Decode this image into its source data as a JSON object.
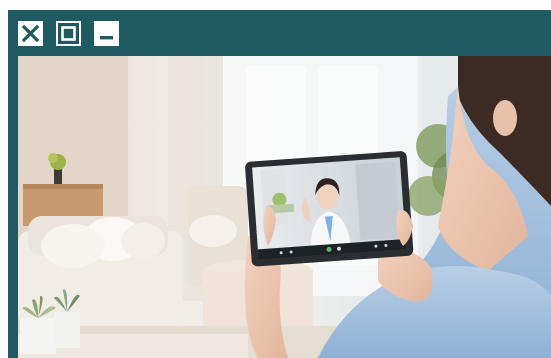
{
  "window": {
    "frame_color": "#1f5961",
    "controls": [
      {
        "name": "close",
        "icon": "close-icon"
      },
      {
        "name": "maximize",
        "icon": "maximize-icon"
      },
      {
        "name": "minimize",
        "icon": "minimize-icon"
      }
    ]
  },
  "content": {
    "image": "telemedicine-video-call-photo"
  }
}
